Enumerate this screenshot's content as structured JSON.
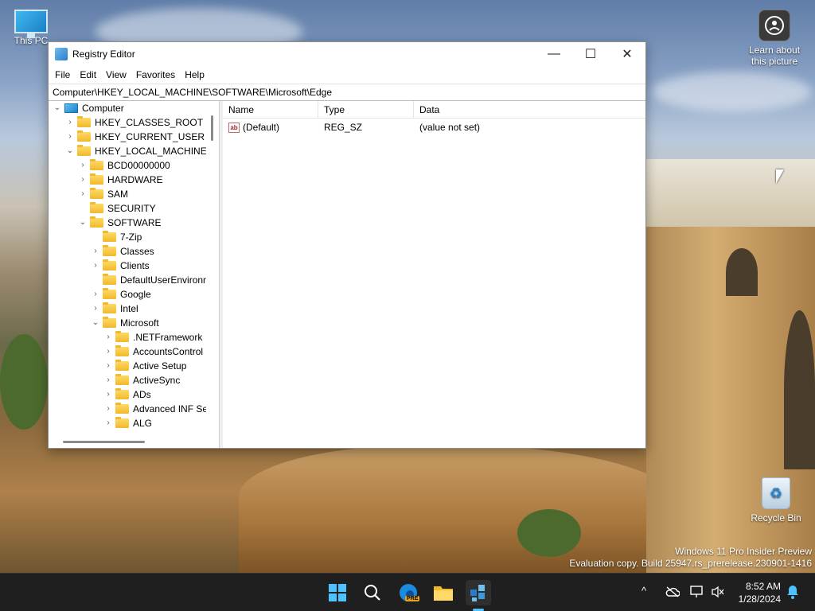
{
  "desktop": {
    "icons": {
      "this_pc": "This PC",
      "learn_picture": "Learn about this picture",
      "recycle_bin": "Recycle Bin"
    },
    "watermark": {
      "line1": "Windows 11 Pro Insider Preview",
      "line2": "Evaluation copy. Build 25947.rs_prerelease.230901-1416"
    }
  },
  "window": {
    "title": "Registry Editor",
    "controls": {
      "minimize": "—",
      "maximize": "☐",
      "close": "✕"
    },
    "menu": [
      "File",
      "Edit",
      "View",
      "Favorites",
      "Help"
    ],
    "address": "Computer\\HKEY_LOCAL_MACHINE\\SOFTWARE\\Microsoft\\Edge",
    "tree": [
      {
        "label": "Computer",
        "depth": 0,
        "state": "expanded",
        "icon": "computer-icon"
      },
      {
        "label": "HKEY_CLASSES_ROOT",
        "depth": 1,
        "state": "collapsed",
        "icon": "folder-icon"
      },
      {
        "label": "HKEY_CURRENT_USER",
        "depth": 1,
        "state": "collapsed",
        "icon": "folder-icon"
      },
      {
        "label": "HKEY_LOCAL_MACHINE",
        "depth": 1,
        "state": "expanded",
        "icon": "folder-icon"
      },
      {
        "label": "BCD00000000",
        "depth": 2,
        "state": "collapsed",
        "icon": "folder-icon"
      },
      {
        "label": "HARDWARE",
        "depth": 2,
        "state": "collapsed",
        "icon": "folder-icon"
      },
      {
        "label": "SAM",
        "depth": 2,
        "state": "collapsed",
        "icon": "folder-icon"
      },
      {
        "label": "SECURITY",
        "depth": 2,
        "state": "leaf",
        "icon": "folder-icon"
      },
      {
        "label": "SOFTWARE",
        "depth": 2,
        "state": "expanded",
        "icon": "folder-icon"
      },
      {
        "label": "7-Zip",
        "depth": 3,
        "state": "leaf",
        "icon": "folder-icon"
      },
      {
        "label": "Classes",
        "depth": 3,
        "state": "collapsed",
        "icon": "folder-icon"
      },
      {
        "label": "Clients",
        "depth": 3,
        "state": "collapsed",
        "icon": "folder-icon"
      },
      {
        "label": "DefaultUserEnvironn",
        "depth": 3,
        "state": "leaf",
        "icon": "folder-icon"
      },
      {
        "label": "Google",
        "depth": 3,
        "state": "collapsed",
        "icon": "folder-icon"
      },
      {
        "label": "Intel",
        "depth": 3,
        "state": "collapsed",
        "icon": "folder-icon"
      },
      {
        "label": "Microsoft",
        "depth": 3,
        "state": "expanded",
        "icon": "folder-icon"
      },
      {
        "label": ".NETFramework",
        "depth": 4,
        "state": "collapsed",
        "icon": "folder-icon"
      },
      {
        "label": "AccountsControl",
        "depth": 4,
        "state": "collapsed",
        "icon": "folder-icon"
      },
      {
        "label": "Active Setup",
        "depth": 4,
        "state": "collapsed",
        "icon": "folder-icon"
      },
      {
        "label": "ActiveSync",
        "depth": 4,
        "state": "collapsed",
        "icon": "folder-icon"
      },
      {
        "label": "ADs",
        "depth": 4,
        "state": "collapsed",
        "icon": "folder-icon"
      },
      {
        "label": "Advanced INF Set",
        "depth": 4,
        "state": "collapsed",
        "icon": "folder-icon"
      },
      {
        "label": "ALG",
        "depth": 4,
        "state": "collapsed",
        "icon": "folder-icon"
      }
    ],
    "columns": [
      "Name",
      "Type",
      "Data"
    ],
    "values": [
      {
        "name": "(Default)",
        "type": "REG_SZ",
        "data": "(value not set)",
        "icon": "ab"
      }
    ]
  },
  "taskbar": {
    "apps": [
      "start-icon",
      "search-icon",
      "edge-beta-icon",
      "file-explorer-icon",
      "registry-editor-icon"
    ],
    "edge_badge": "PRE",
    "tray": {
      "chevron": "^"
    },
    "clock": {
      "time": "8:52 AM",
      "date": "1/28/2024"
    }
  },
  "colors": {
    "taskbar": "#1f1f1f",
    "accent": "#4cc2ff",
    "folder": "#f2b92b"
  }
}
